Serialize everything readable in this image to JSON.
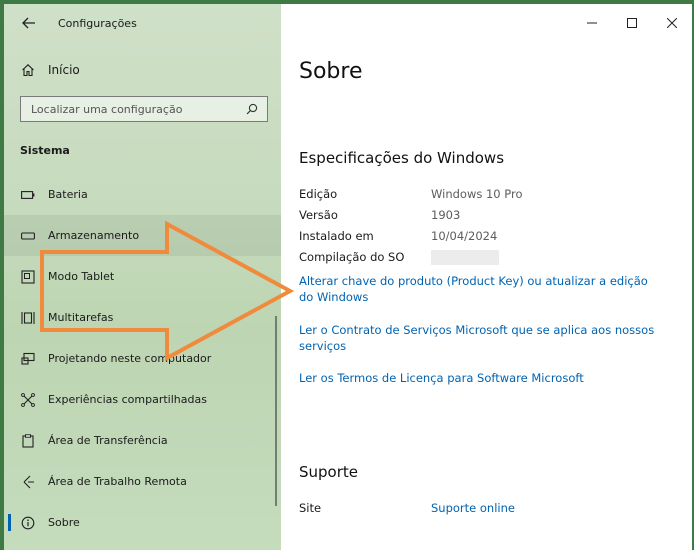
{
  "window": {
    "title": "Configurações"
  },
  "sidebar": {
    "home_label": "Início",
    "search_placeholder": "Localizar uma configuração",
    "section_title": "Sistema",
    "items": [
      {
        "label": "Bateria",
        "icon": "battery-icon"
      },
      {
        "label": "Armazenamento",
        "icon": "storage-icon"
      },
      {
        "label": "Modo Tablet",
        "icon": "tablet-mode-icon"
      },
      {
        "label": "Multitarefas",
        "icon": "multitasking-icon"
      },
      {
        "label": "Projetando neste computador",
        "icon": "projecting-icon"
      },
      {
        "label": "Experiências compartilhadas",
        "icon": "shared-experiences-icon"
      },
      {
        "label": "Área de Transferência",
        "icon": "clipboard-icon"
      },
      {
        "label": "Área de Trabalho Remota",
        "icon": "remote-desktop-icon"
      },
      {
        "label": "Sobre",
        "icon": "info-icon"
      }
    ]
  },
  "main": {
    "title": "Sobre",
    "specs_heading": "Especificações do Windows",
    "specs": [
      {
        "label": "Edição",
        "value": "Windows 10 Pro"
      },
      {
        "label": "Versão",
        "value": "1903"
      },
      {
        "label": "Instalado em",
        "value": "10/04/2024"
      },
      {
        "label": "Compilação do SO",
        "value": ""
      }
    ],
    "links": [
      "Alterar chave do produto (Product Key) ou atualizar a edição do Windows",
      "Ler o Contrato de Serviços Microsoft que se aplica aos nossos serviços",
      "Ler os Termos de Licença para Software Microsoft"
    ],
    "support_heading": "Suporte",
    "support_site_label": "Site",
    "support_site_link": "Suporte online"
  },
  "colors": {
    "accent": "#0063b1",
    "arrow": "#f08a3c"
  }
}
